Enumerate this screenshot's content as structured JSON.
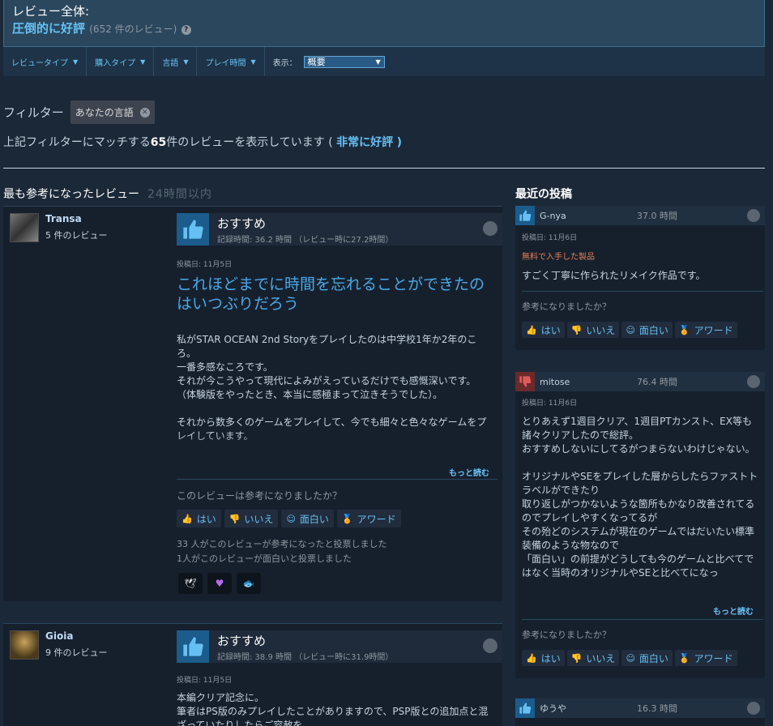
{
  "summary": {
    "label": "レビュー全体:",
    "rating": "圧倒的に好評",
    "count": "(652 件のレビュー)",
    "help_icon_glyph": "?"
  },
  "filters": {
    "review_type": "レビュータイプ",
    "purchase_type": "購入タイプ",
    "language": "言語",
    "playtime": "プレイ時間",
    "display_label": "表示：",
    "display_value": "概要"
  },
  "active_filter": {
    "label": "フィルター",
    "chip": "あなたの言語"
  },
  "match": {
    "prefix": "上記フィルターにマッチする",
    "count": "65",
    "middle": "件のレビューを表示しています (",
    "rating": "非常に好評",
    "suffix": ")"
  },
  "sections": {
    "most_helpful": "最も参考になったレビュー",
    "most_helpful_sub": "24時間以内",
    "recent": "最近の投稿"
  },
  "reviews": [
    {
      "name": "Transa",
      "count": "5 件のレビュー",
      "verdict": "おすすめ",
      "hours": "記録時間: 36.2 時間 （レビュー時に27.2時間）",
      "date": "投稿日: 11月5日",
      "title": "これほどまでに時間を忘れることができたのはいつぶりだろう",
      "body": [
        "私がSTAR OCEAN 2nd Storyをプレイしたのは中学校1年か2年のころ。",
        "一番多感なころです。",
        "それが今こうやって現代によみがえっているだけでも感慨深いです。",
        "（体験版をやったとき、本当に感極まって泣きそうでした）。",
        "",
        "それから数多くのゲームをプレイして、今でも細々と色々なゲームをプレイしています。"
      ],
      "read_more": "もっと読む",
      "helpful_q": "このレビューは参考になりましたか？",
      "tally": [
        "33 人がこのレビューが参考になったと投票しました",
        "1人がこのレビューが面白いと投票しました"
      ]
    },
    {
      "name": "Gioia",
      "count": "9 件のレビュー",
      "verdict": "おすすめ",
      "hours": "記録時間: 38.9 時間 （レビュー時に31.9時間）",
      "date": "投稿日: 11月5日",
      "body": [
        "本編クリア記念に。",
        "筆者はPS版のみプレイしたことがありますので、PSP版との追加点と混ざっていたりしたらご容赦を。"
      ]
    }
  ],
  "buttons": {
    "yes": "はい",
    "no": "いいえ",
    "funny": "面白い",
    "award": "アワード"
  },
  "recent": [
    {
      "name": "G-nya",
      "hours": "37.0 時間",
      "date": "投稿日: 11月6日",
      "free": "無料で入手した製品",
      "body": [
        "すごく丁寧に作られたリメイク作品です。"
      ],
      "helpful_q": "参考になりましたか？"
    },
    {
      "name": "mitose",
      "hours": "76.4 時間",
      "date": "投稿日: 11月6日",
      "body": [
        "とりあえず1週目クリア、1週目PTカンスト、EX等も諸々クリアしたので総評。",
        "おすすめしないにしてるがつまらないわけじゃない。",
        "",
        "オリジナルやSEをプレイした層からしたらファストトラベルができたり",
        "取り返しがつかないような箇所もかなり改善されてるのでプレイしやすくなってるが",
        "その殆どのシステムが現在のゲームではだいたい標準装備のような物なので",
        "「面白い」の前提がどうしても今のゲームと比べてではなく当時のオリジナルやSEと比べてになっ"
      ],
      "read_more": "もっと読む",
      "helpful_q": "参考になりましたか？"
    },
    {
      "name": "ゆうや",
      "hours": "16.3 時間"
    }
  ]
}
